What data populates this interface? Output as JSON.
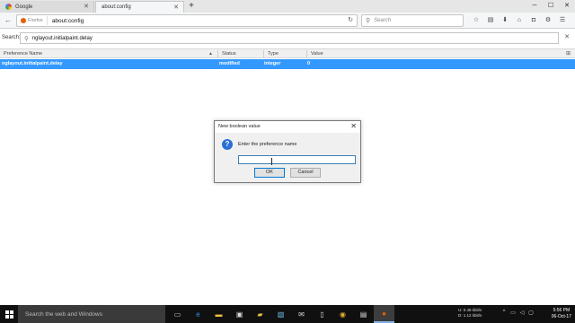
{
  "tabs": [
    {
      "title": "Google",
      "active": false
    },
    {
      "title": "about:config",
      "active": true
    }
  ],
  "navbar": {
    "identity_label": "Firefox",
    "url": "about:config",
    "search_placeholder": "Search"
  },
  "config_search": {
    "label": "Search:",
    "value": "nglayout.initialpaint.delay"
  },
  "table": {
    "columns": [
      "Preference Name",
      "Status",
      "Type",
      "Value"
    ],
    "rows": [
      {
        "name": "nglayout.initialpaint.delay",
        "status": "modified",
        "type": "integer",
        "value": "0"
      }
    ]
  },
  "dialog": {
    "title": "New boolean value",
    "prompt": "Enter the preference name",
    "input_value": "",
    "ok_label": "OK",
    "cancel_label": "Cancel"
  },
  "taskbar": {
    "search_placeholder": "Search the web and Windows",
    "net_up": "0.48 kbit/s",
    "net_down": "1.12 kbit/s",
    "net_up_label": "U:",
    "net_down_label": "D:",
    "time": "5:56 PM",
    "date": "06-Oct-17"
  },
  "colors": {
    "selection": "#3399ff",
    "taskbar": "#101010",
    "firefox_accent": "#e66000"
  }
}
